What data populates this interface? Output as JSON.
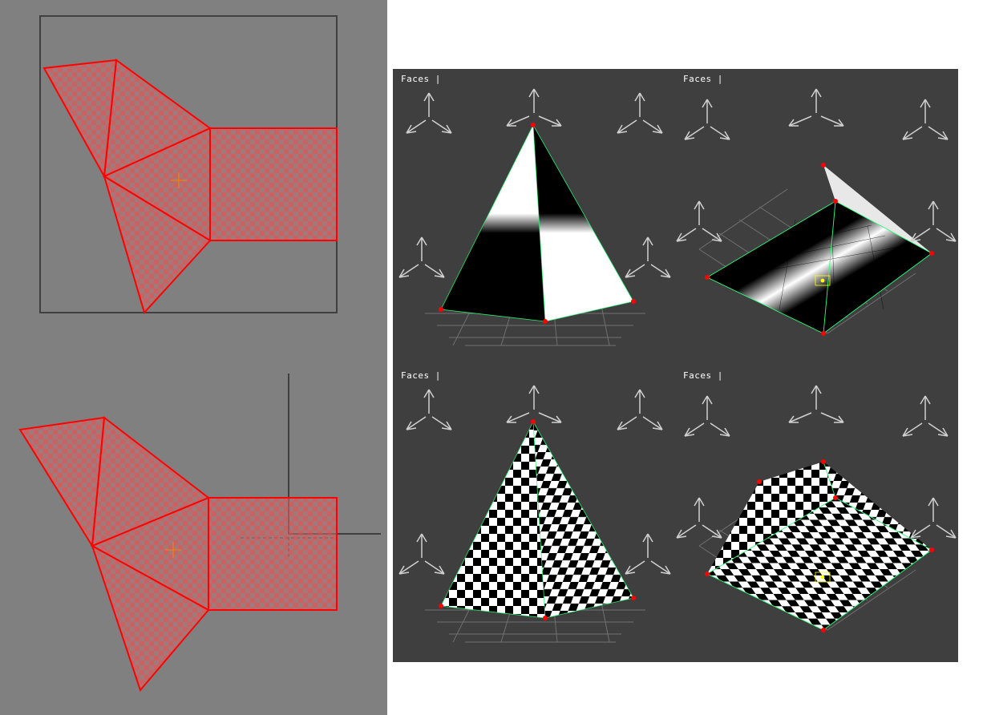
{
  "uv_editors": {
    "top": {
      "selected_faces": 5,
      "cursor_color": "#ff8000"
    },
    "bottom": {
      "selected_faces": 5,
      "cursor_color": "#ff8000"
    }
  },
  "viewports": {
    "top_left": {
      "label": "Faces |",
      "material": "checker-1x",
      "view": "perspective-low"
    },
    "top_right": {
      "label": "Faces |",
      "material": "checker-1x",
      "view": "perspective-high"
    },
    "bottom_left": {
      "label": "Faces |",
      "material": "checker-8x",
      "view": "perspective-low"
    },
    "bottom_right": {
      "label": "Faces |",
      "material": "checker-8x",
      "view": "perspective-high"
    }
  },
  "geometry": {
    "object": "pyramid",
    "face_count": 4,
    "vertex_color": "#ff0000",
    "edge_select_color": "#00ff00"
  },
  "colors": {
    "uv_bg": "#808080",
    "uv_frame": "#404040",
    "uv_select": "#ff0000",
    "viewport_bg": "#3f3f3f"
  }
}
